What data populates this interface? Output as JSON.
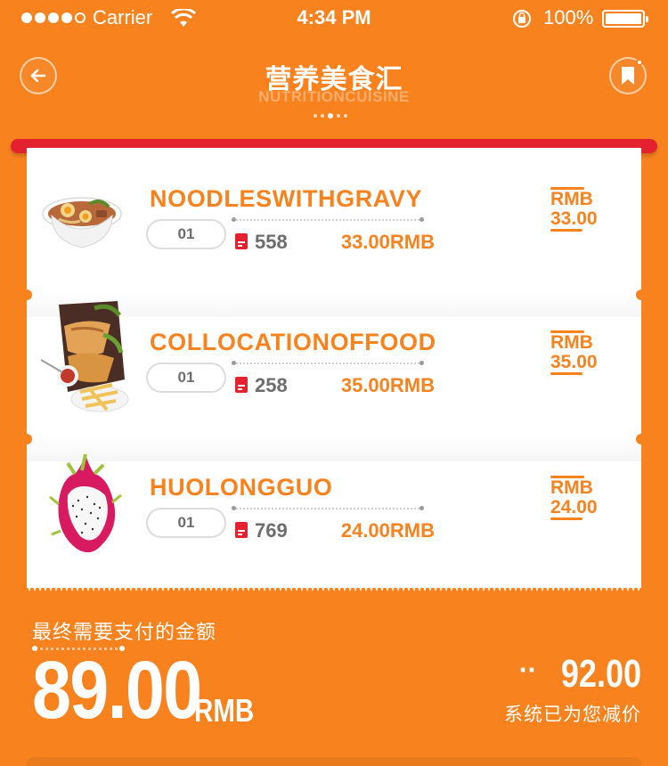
{
  "status_bar": {
    "carrier": "Carrier",
    "time": "4:34 PM",
    "battery": "100%"
  },
  "header": {
    "title": "营养美食汇",
    "subtitle": "NUTRITIONCUISINE"
  },
  "items": [
    {
      "name": "NOODLESWITHGRAVY",
      "qty": "01",
      "count": "558",
      "subtotal": "33.00RMB",
      "price_unit": "RMB",
      "price": "33.00",
      "image": "noodle-bowl"
    },
    {
      "name": "COLLOCATIONOFFOOD",
      "qty": "01",
      "count": "258",
      "subtotal": "35.00RMB",
      "price_unit": "RMB",
      "price": "35.00",
      "image": "food-platter"
    },
    {
      "name": "HUOLONGGUO",
      "qty": "01",
      "count": "769",
      "subtotal": "24.00RMB",
      "price_unit": "RMB",
      "price": "24.00",
      "image": "dragon-fruit"
    }
  ],
  "summary": {
    "pay_label": "最终需要支付的金额",
    "pay_amount": "89.00",
    "pay_unit": "RMB",
    "discount_value": "92.00",
    "discount_label": "系统已为您减价"
  },
  "colors": {
    "background": "#f7821e",
    "accent_red": "#e4212f",
    "card": "#ffffff"
  },
  "icons": [
    "back-arrow-icon",
    "bookmark-icon",
    "wifi-icon",
    "rotation-lock-icon",
    "document-icon"
  ]
}
